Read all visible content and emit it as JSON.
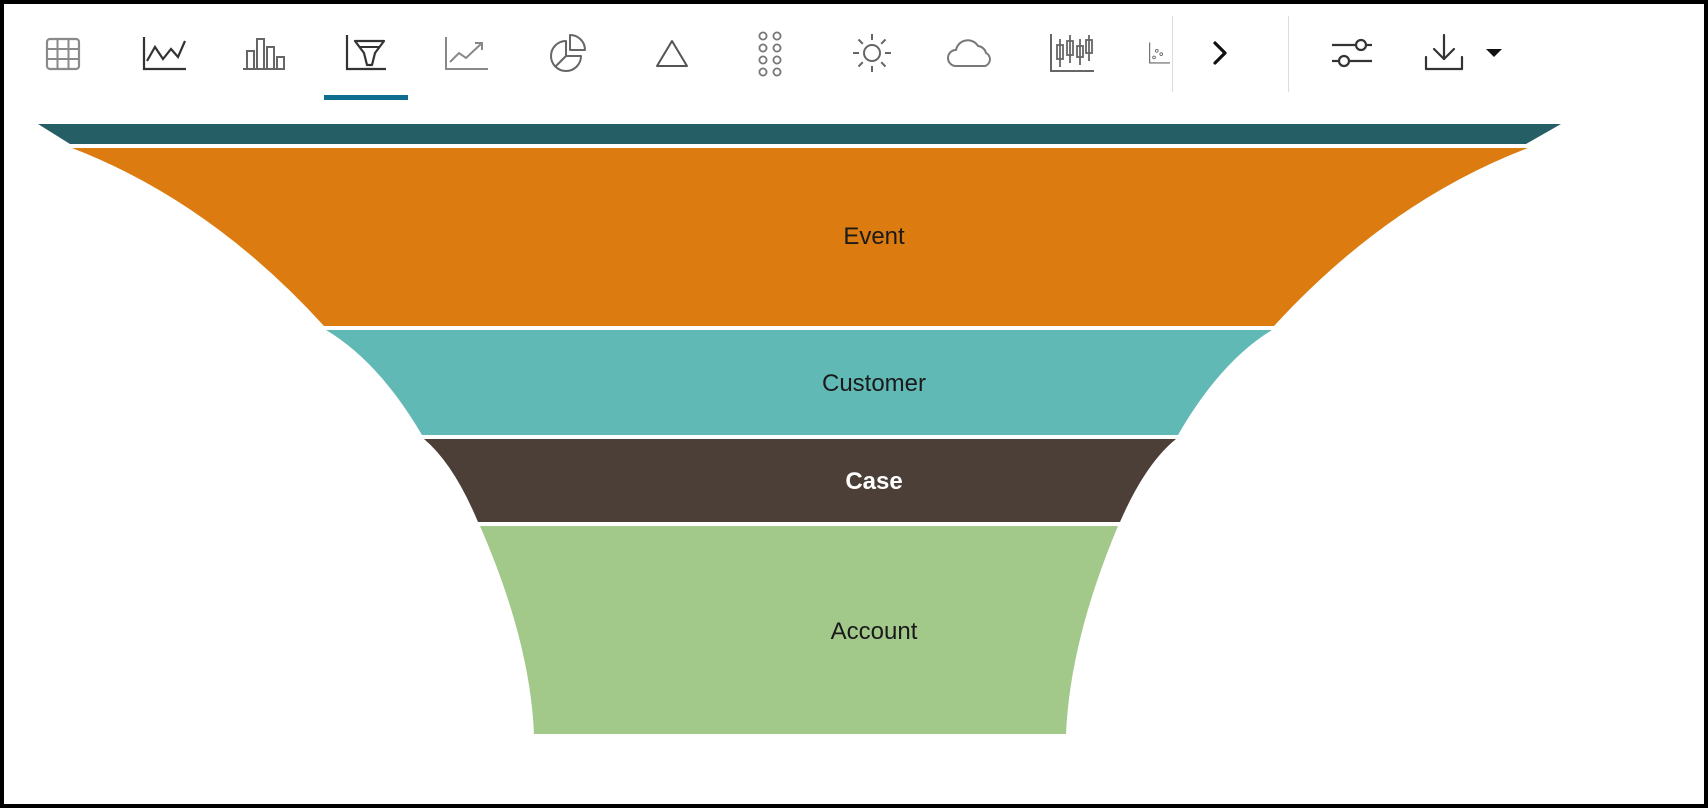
{
  "toolbar": {
    "buttons": [
      {
        "name": "table-view-button",
        "icon": "table-grid-icon",
        "active": false
      },
      {
        "name": "line-chart-button",
        "icon": "line-chart-icon",
        "active": false
      },
      {
        "name": "bar-chart-button",
        "icon": "bar-chart-icon",
        "active": false
      },
      {
        "name": "funnel-chart-button",
        "icon": "funnel-chart-icon",
        "active": true
      },
      {
        "name": "trend-chart-button",
        "icon": "trend-chart-icon",
        "active": false
      },
      {
        "name": "pie-chart-button",
        "icon": "pie-chart-icon",
        "active": false
      },
      {
        "name": "triangle-chart-button",
        "icon": "triangle-icon",
        "active": false
      },
      {
        "name": "dot-matrix-button",
        "icon": "dot-matrix-icon",
        "active": false
      },
      {
        "name": "sunburst-button",
        "icon": "sun-icon",
        "active": false
      },
      {
        "name": "word-cloud-button",
        "icon": "cloud-icon",
        "active": false
      },
      {
        "name": "candlestick-button",
        "icon": "candlestick-icon",
        "active": false
      },
      {
        "name": "scatter-chart-button",
        "icon": "scatter-chart-icon",
        "active": false
      }
    ],
    "more_icon": "chevron-right-icon",
    "settings_icon": "sliders-icon",
    "download_icon": "download-icon",
    "dropdown_icon": "caret-down-icon",
    "accent_color": "#0f6d8f"
  },
  "chart_data": {
    "type": "funnel",
    "stages": [
      {
        "label": "",
        "color": "#255f65"
      },
      {
        "label": "Event",
        "color": "#dc7c10"
      },
      {
        "label": "Customer",
        "color": "#61b9b6"
      },
      {
        "label": "Case",
        "color": "#4c3f37"
      },
      {
        "label": "Account",
        "color": "#a2c98a"
      }
    ]
  }
}
